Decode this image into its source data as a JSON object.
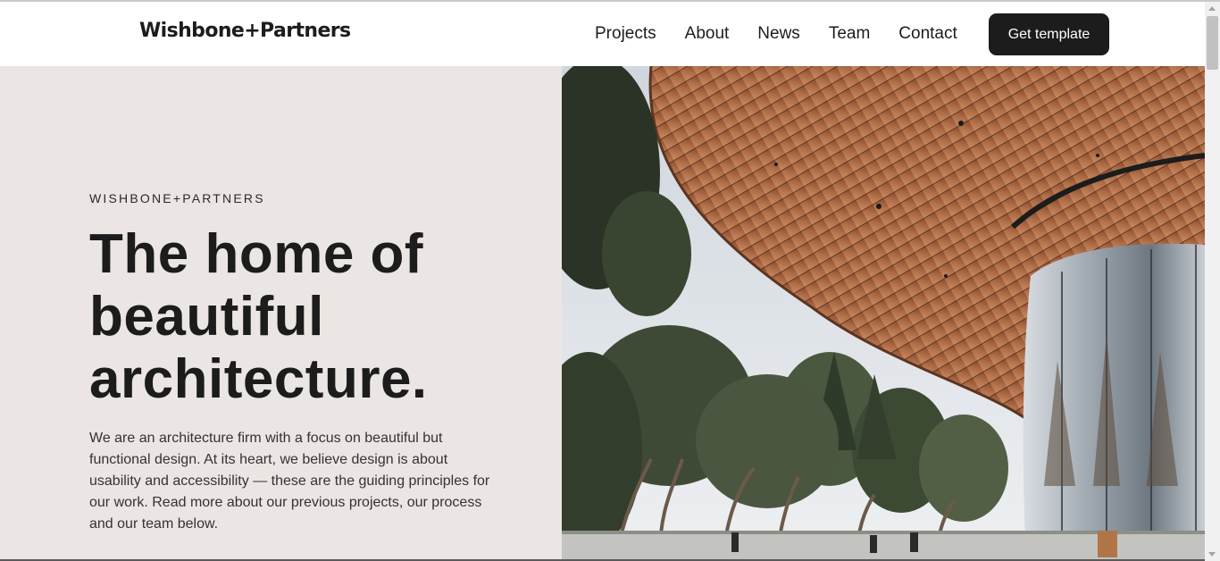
{
  "header": {
    "logo": "Wishbone+Partners",
    "nav": [
      "Projects",
      "About",
      "News",
      "Team",
      "Contact"
    ],
    "cta_label": "Get template"
  },
  "hero": {
    "eyebrow": "WISHBONE+PARTNERS",
    "headline": "The home of beautiful architecture.",
    "intro": "We are an architecture firm with a focus on beautiful but functional design. At its heart, we believe design is about usability and accessibility — these are the guiding principles for our work. Read more about our previous projects, our process and our team below.",
    "image": "modern-building-curved-wood-canopy-photo"
  },
  "colors": {
    "hero_background": "#ebe6e3",
    "button_background": "#1c1c1c",
    "text": "#1c1c1c",
    "wood": "#a5623d"
  }
}
